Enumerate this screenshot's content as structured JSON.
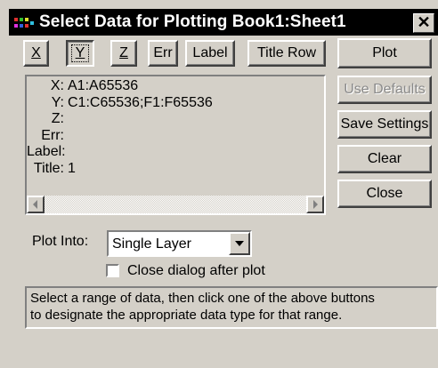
{
  "window": {
    "title": "Select Data for Plotting  Book1:Sheet1",
    "close_symbol": "✕"
  },
  "assign_buttons": {
    "x": "X",
    "y": "Y",
    "z": "Z",
    "err": "Err",
    "label": "Label",
    "title_row": "Title Row"
  },
  "summary": [
    {
      "key": "X:",
      "value": "A1:A65536"
    },
    {
      "key": "Y:",
      "value": "C1:C65536;F1:F65536"
    },
    {
      "key": "Z:",
      "value": ""
    },
    {
      "key": "Err:",
      "value": ""
    },
    {
      "key": "Label:",
      "value": ""
    },
    {
      "key": "Title:",
      "value": "1"
    }
  ],
  "side_buttons": {
    "plot": "Plot",
    "use_defaults": "Use Defaults",
    "save_settings": "Save Settings",
    "clear": "Clear",
    "close": "Close"
  },
  "plot_into": {
    "label": "Plot Into:",
    "value": "Single Layer"
  },
  "close_after_plot": {
    "label": "Close dialog after plot",
    "checked": false
  },
  "status_text": [
    "Select a range of data, then click one of the above buttons",
    "to designate the appropriate data type for that range."
  ],
  "icons": {
    "title": "spreadsheet-app-icon",
    "scroll_left": "arrow-left-icon",
    "scroll_right": "arrow-right-icon",
    "dropdown": "chevron-down-icon"
  }
}
